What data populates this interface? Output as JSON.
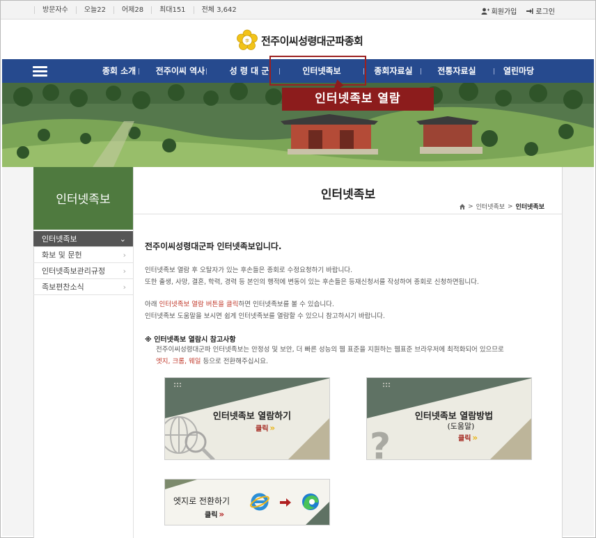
{
  "topbar": {
    "visits": [
      "방문자수",
      "오늘22",
      "어제28",
      "최대151",
      "전체 3,642"
    ],
    "join_label": "회원가입",
    "login_label": "로그인"
  },
  "header": {
    "site_name": "전주이씨성령대군파종회"
  },
  "nav": {
    "items": [
      "종회 소개",
      "전주이씨 역사",
      "성 령 대 군",
      "인터넷족보",
      "종회자료실",
      "전통자료실",
      "열린마당"
    ]
  },
  "banner": {
    "callout": "인터넷족보 열람"
  },
  "sidebar": {
    "title": "인터넷족보",
    "items": [
      "인터넷족보",
      "화보 및 문헌",
      "인터넷족보관리규정",
      "족보편찬소식"
    ]
  },
  "main": {
    "title": "인터넷족보",
    "breadcrumb": [
      "인터넷족보",
      "인터넷족보"
    ],
    "intro": "전주이씨성령대군파 인터넷족보입니다.",
    "para1_line1": "인터넷족보 열람 후 오탈자가 있는 후손들은 종회로 수정요청하기 바랍니다.",
    "para1_line2": "또한 출생, 사망, 결혼, 학력, 경력 등 본인의 행적에 변동이 있는 후손들은 등재신청서를 작성하여 종회로 신청하면됩니다.",
    "para2_prefix": "아래 ",
    "para2_red": "인터넷족보 열람 버튼을 클릭",
    "para2_suffix": "하면 인터넷족보를 볼 수 있습니다.",
    "para2_line2": "인터넷족보 도움말을 보시면 쉽게 인터넷족보를 열람할 수 있으니 참고하시기 바랍니다.",
    "note_title": "※ 인터넷족보 열람시 참고사항",
    "note_line1": "전주이씨성령대군파 인터넷족보는 안정성 및 보안, 더 빠른 성능의 웹 표준을 지원하는 웹표준 브라우저에 최적화되어 있으므로",
    "note_red": "엣지, 크롬, 웨일",
    "note_suffix": " 등으로 전환해주십시요."
  },
  "cards": {
    "view": {
      "title": "인터넷족보  열람하기",
      "click": "클릭"
    },
    "help": {
      "title": "인터넷족보  열람방법",
      "sub": "(도움말)",
      "click": "클릭"
    },
    "edge": {
      "title": "엣지로 전환하기",
      "click": "클릭"
    }
  },
  "colors": {
    "nav_blue": "#264a8e",
    "side_green": "#4f7a3f",
    "accent_red": "#8c1c1c",
    "click_yellow": "#e8b415"
  }
}
